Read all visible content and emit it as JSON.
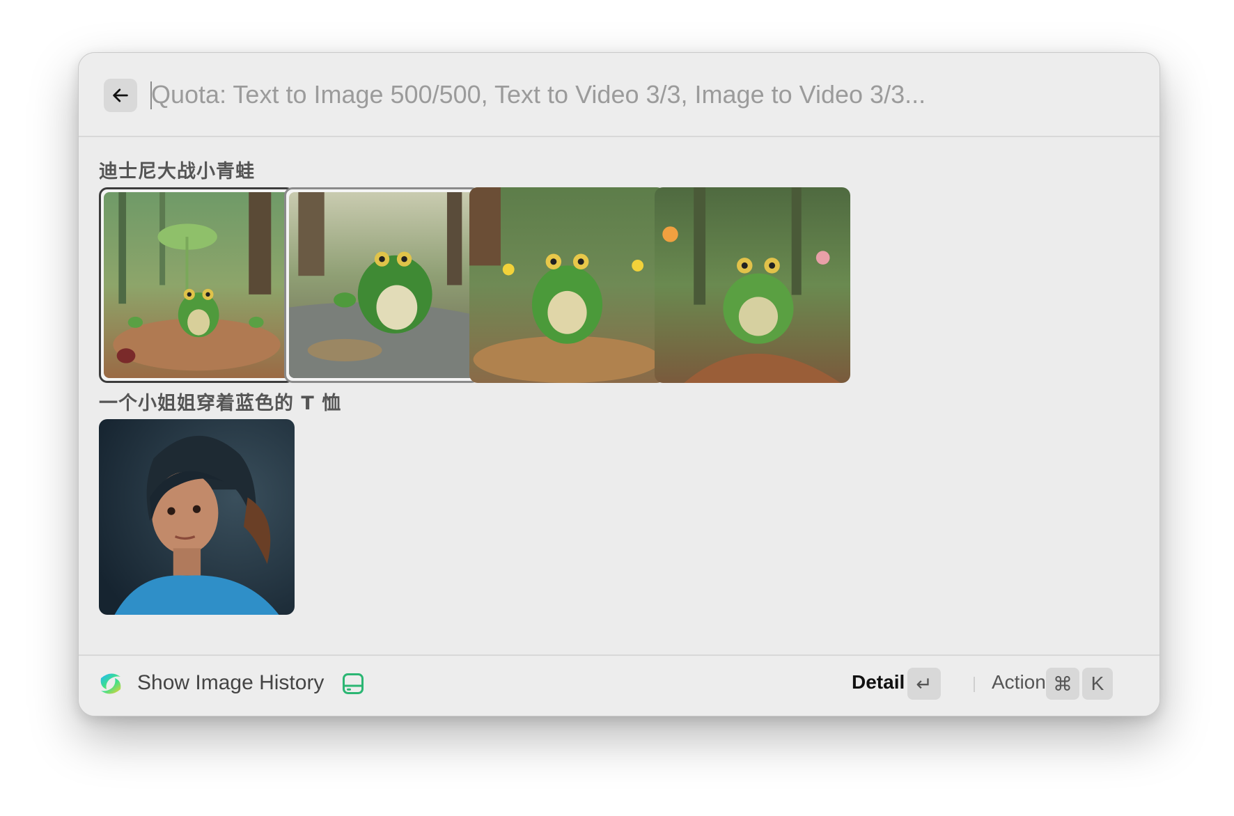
{
  "search": {
    "placeholder": "Quota: Text to Image 500/500, Text to Video 3/3, Image to Video 3/3..."
  },
  "groups": [
    {
      "title": "迪士尼大战小青蛙",
      "images": [
        {
          "alt": "frog-forest-lilypad",
          "state": "selected"
        },
        {
          "alt": "frog-stream-waving",
          "state": "hovered"
        },
        {
          "alt": "frog-puddle-yellow-flowers",
          "state": "normal"
        },
        {
          "alt": "frog-rock-pink-flower",
          "state": "normal"
        }
      ]
    },
    {
      "title": "一个小姐姐穿着蓝色的 T 恤",
      "images": [
        {
          "alt": "girl-blue-tshirt",
          "state": "normal"
        }
      ]
    }
  ],
  "footer": {
    "title": "Show Image History",
    "detail_label": "Detail",
    "enter_key": "↵",
    "actions_label": "Actions",
    "cmd_key": "⌘",
    "k_key": "K"
  },
  "colors": {
    "window_bg": "#ececec",
    "history_icon": "#2bb673",
    "kbd_bg": "#d8d8d8"
  }
}
